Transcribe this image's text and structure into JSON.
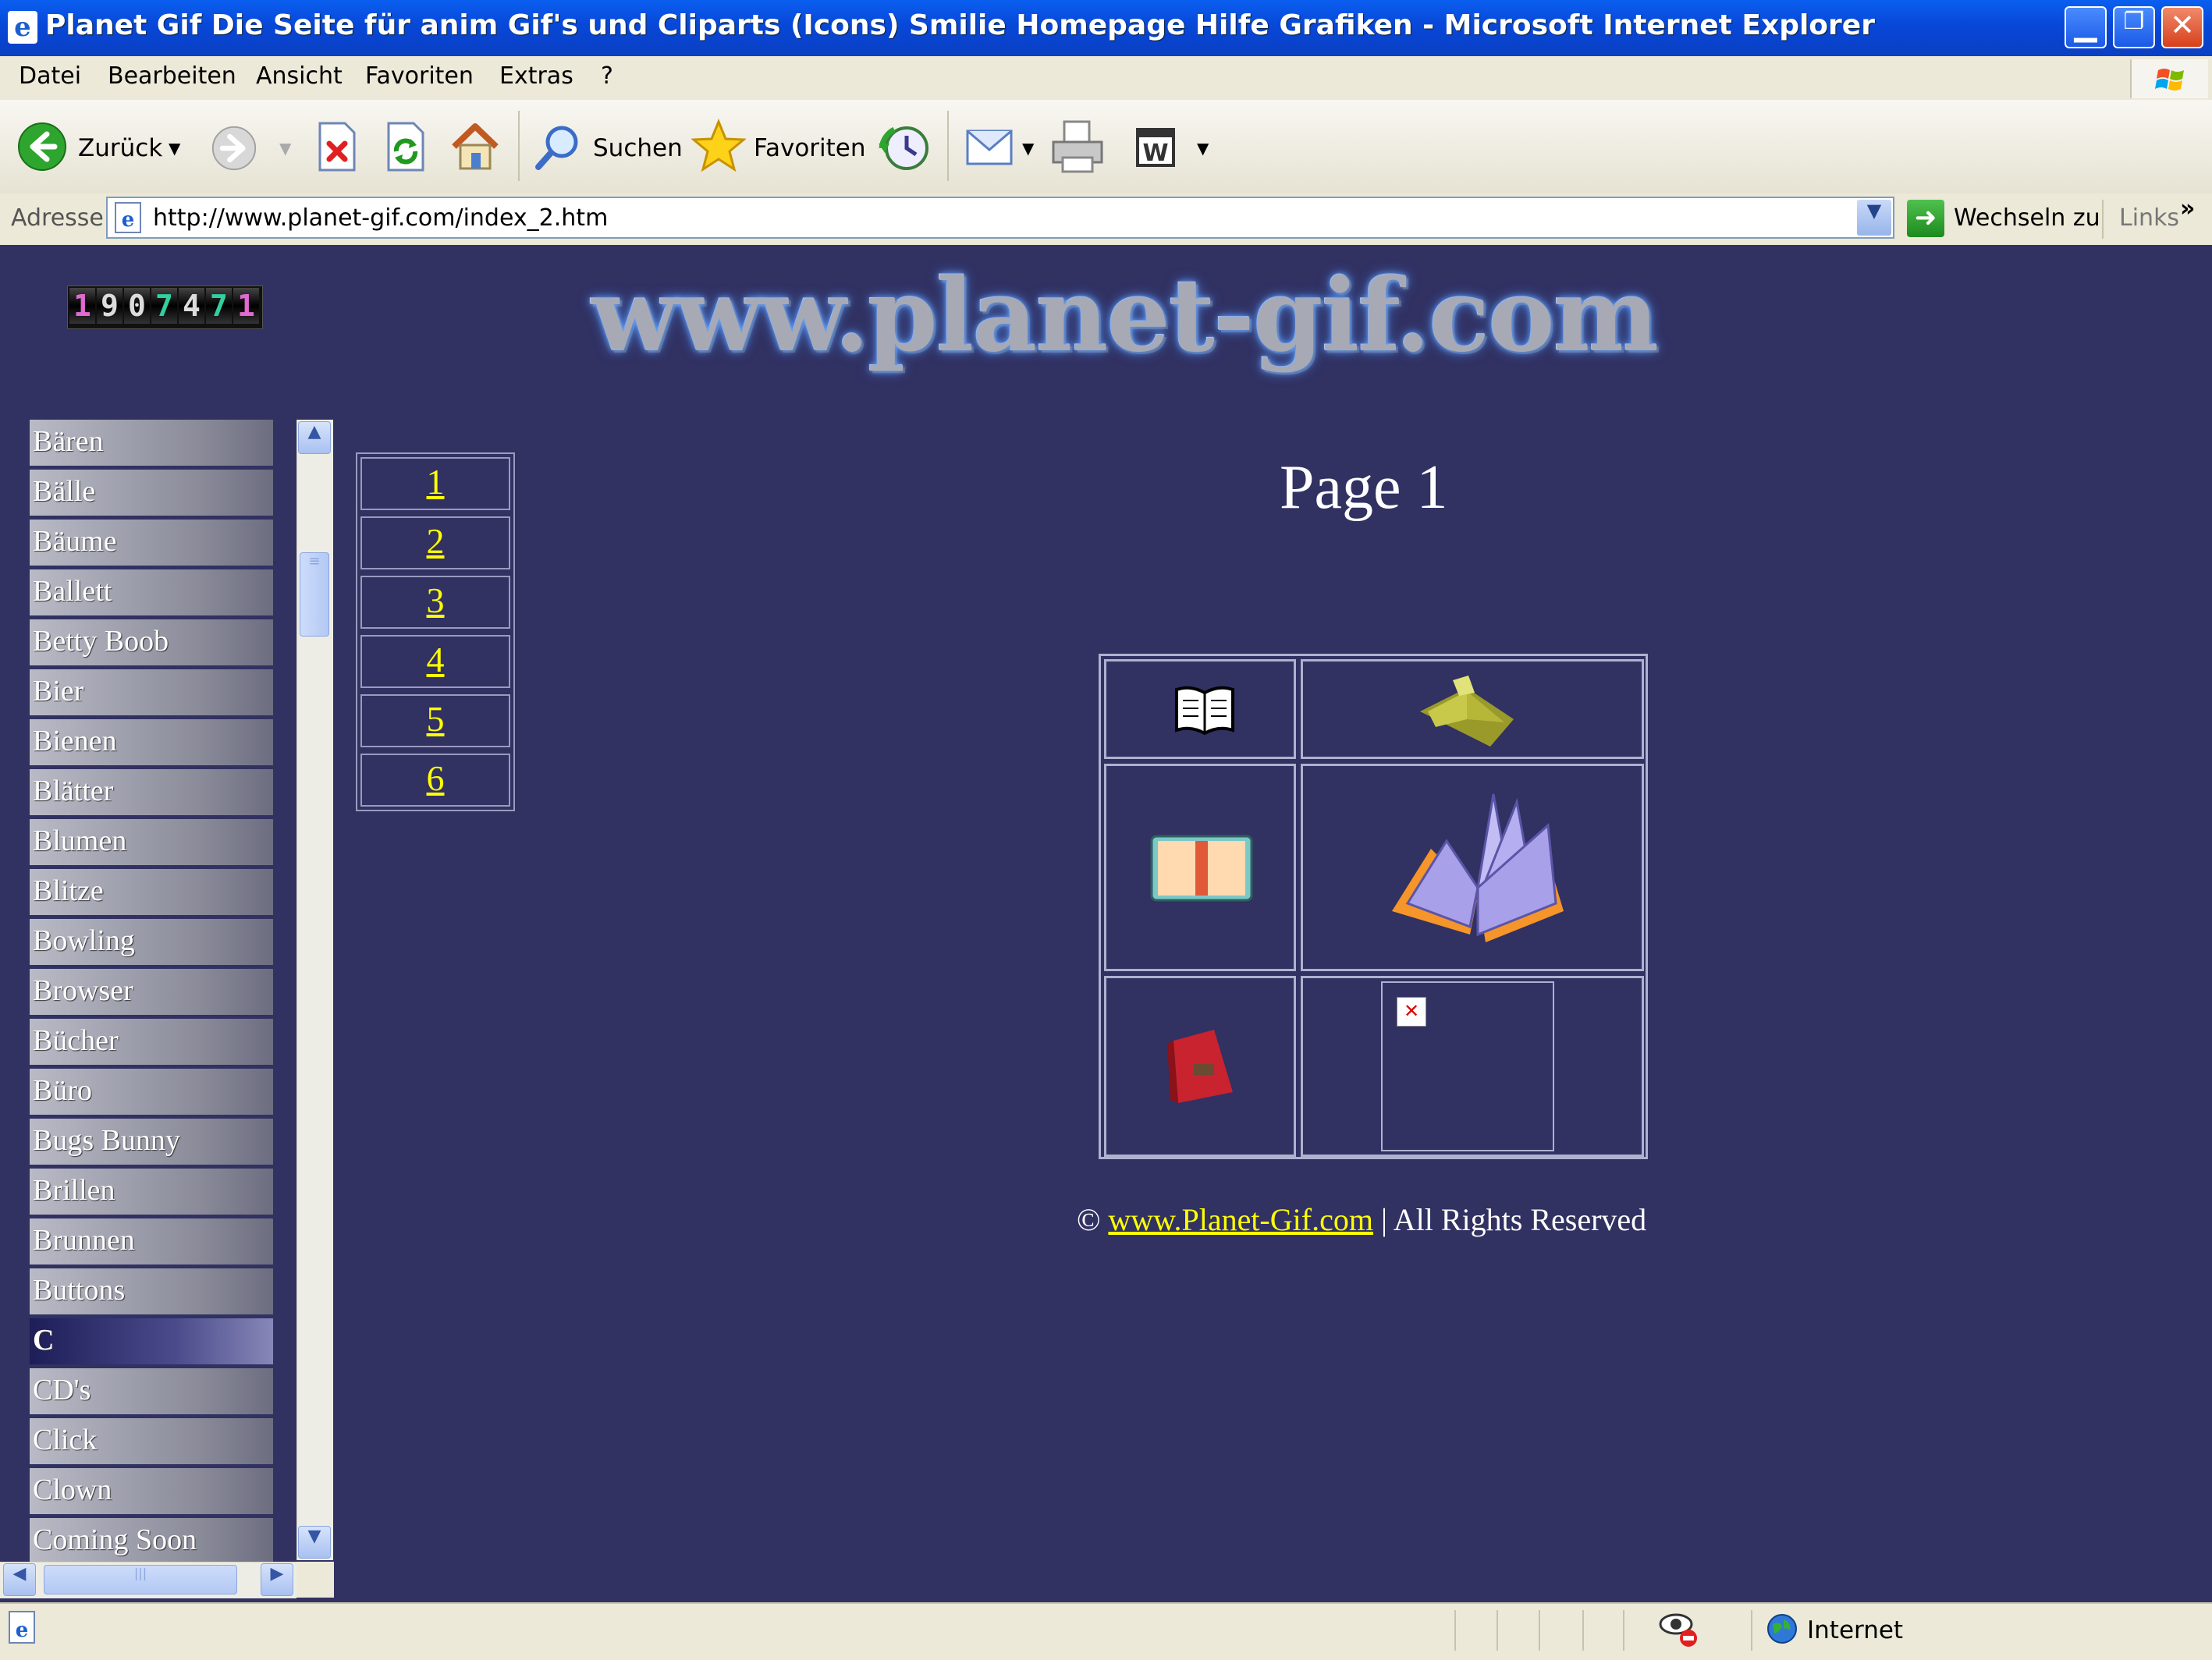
{
  "window": {
    "title": "Planet Gif Die Seite für anim Gif's und Cliparts (Icons) Smilie Homepage Hilfe Grafiken - Microsoft Internet Explorer",
    "minimize": "▁",
    "restore": "❐",
    "close": "✕"
  },
  "menu": [
    "Datei",
    "Bearbeiten",
    "Ansicht",
    "Favoriten",
    "Extras",
    "?"
  ],
  "toolbar": {
    "back": "Zurück",
    "search": "Suchen",
    "favorites": "Favoriten"
  },
  "address": {
    "label": "Adresse",
    "url": "http://www.planet-gif.com/index_2.htm",
    "go": "Wechseln zu",
    "links": "Links",
    "chevron": "»"
  },
  "counter": [
    "1",
    "9",
    "0",
    "7",
    "4",
    "7",
    "1"
  ],
  "counter_colors": [
    "#e06ad0",
    "#dcdcdc",
    "#dcdcdc",
    "#30d0a0",
    "#dcdcdc",
    "#30d0a0",
    "#e06ad0"
  ],
  "nav": {
    "items": [
      "Bären",
      "Bälle",
      "Bäume",
      "Ballett",
      "Betty Boob",
      "Bier",
      "Bienen",
      "Blätter",
      "Blumen",
      "Blitze",
      "Bowling",
      "Browser",
      "Bücher",
      "Büro",
      "Bugs Bunny",
      "Brillen",
      "Brunnen",
      "Buttons",
      "C",
      "CD's",
      "Click",
      "Clown",
      "Coming Soon"
    ],
    "active_index": 18
  },
  "banner": "www.planet-gif.com",
  "pages": [
    "1",
    "2",
    "3",
    "4",
    "5",
    "6"
  ],
  "page_title": "Page 1",
  "broken_image_icon": "✕",
  "footer": {
    "copyright_symbol": "©",
    "link": "www.Planet-Gif.com",
    "rest": "| All Rights Reserved"
  },
  "status": {
    "zone": "Internet"
  },
  "colors": {
    "page_bg": "#313162",
    "link": "#ffff00",
    "titlebar": "#0a5ff0"
  }
}
